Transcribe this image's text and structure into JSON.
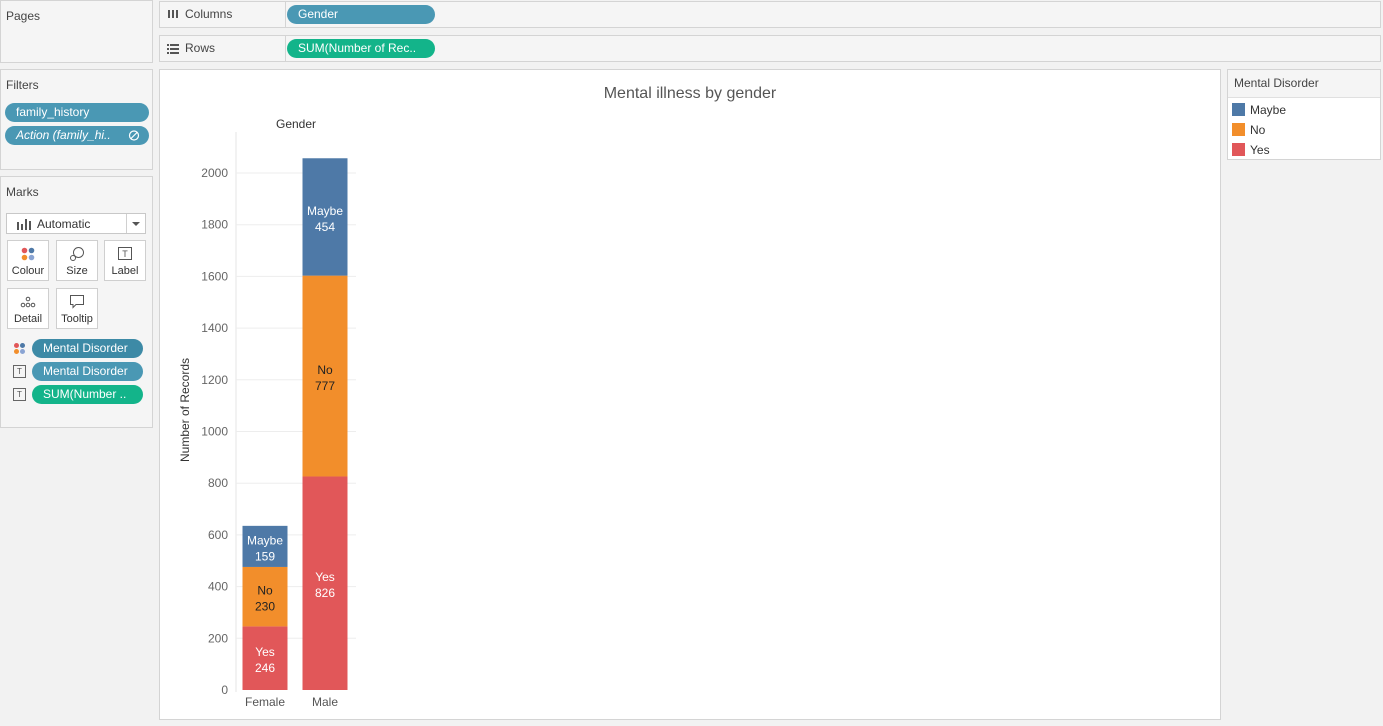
{
  "pages": {
    "title": "Pages"
  },
  "shelves": {
    "columns": {
      "label": "Columns",
      "icon": "columns-icon",
      "pill": "Gender"
    },
    "rows": {
      "label": "Rows",
      "icon": "rows-icon",
      "pill": "SUM(Number of Rec.."
    }
  },
  "filters": {
    "title": "Filters",
    "items": [
      {
        "label": "family_history"
      },
      {
        "label": "Action (family_hi..",
        "icon": "linked-action-icon"
      }
    ]
  },
  "marks": {
    "title": "Marks",
    "type_select": "Automatic",
    "buttons": [
      {
        "label": "Colour",
        "icon": "colour-icon"
      },
      {
        "label": "Size",
        "icon": "size-icon"
      },
      {
        "label": "Label",
        "icon": "label-icon"
      },
      {
        "label": "Detail",
        "icon": "detail-icon"
      },
      {
        "label": "Tooltip",
        "icon": "tooltip-icon"
      }
    ],
    "fields": [
      {
        "icon": "colour-icon",
        "label": "Mental Disorder"
      },
      {
        "icon": "label-icon",
        "label": "Mental Disorder"
      },
      {
        "icon": "label-icon",
        "label": "SUM(Number .."
      }
    ]
  },
  "legend": {
    "title": "Mental Disorder",
    "items": [
      {
        "label": "Maybe",
        "color": "#4e79a7"
      },
      {
        "label": "No",
        "color": "#f28e2b"
      },
      {
        "label": "Yes",
        "color": "#e15759"
      }
    ]
  },
  "chart_data": {
    "type": "bar",
    "stacked": true,
    "title": "Mental illness by gender",
    "column_header": "Gender",
    "ylabel": "Number of Records",
    "xlabel": "",
    "categories": [
      "Female",
      "Male"
    ],
    "ylim": [
      0,
      2100
    ],
    "yticks": [
      0,
      200,
      400,
      600,
      800,
      1000,
      1200,
      1400,
      1600,
      1800,
      2000
    ],
    "grid": true,
    "legend_position": "right",
    "series": [
      {
        "name": "Yes",
        "color": "#e15759",
        "values": [
          246,
          826
        ]
      },
      {
        "name": "No",
        "color": "#f28e2b",
        "values": [
          230,
          777
        ]
      },
      {
        "name": "Maybe",
        "color": "#4e79a7",
        "values": [
          159,
          454
        ]
      }
    ]
  }
}
